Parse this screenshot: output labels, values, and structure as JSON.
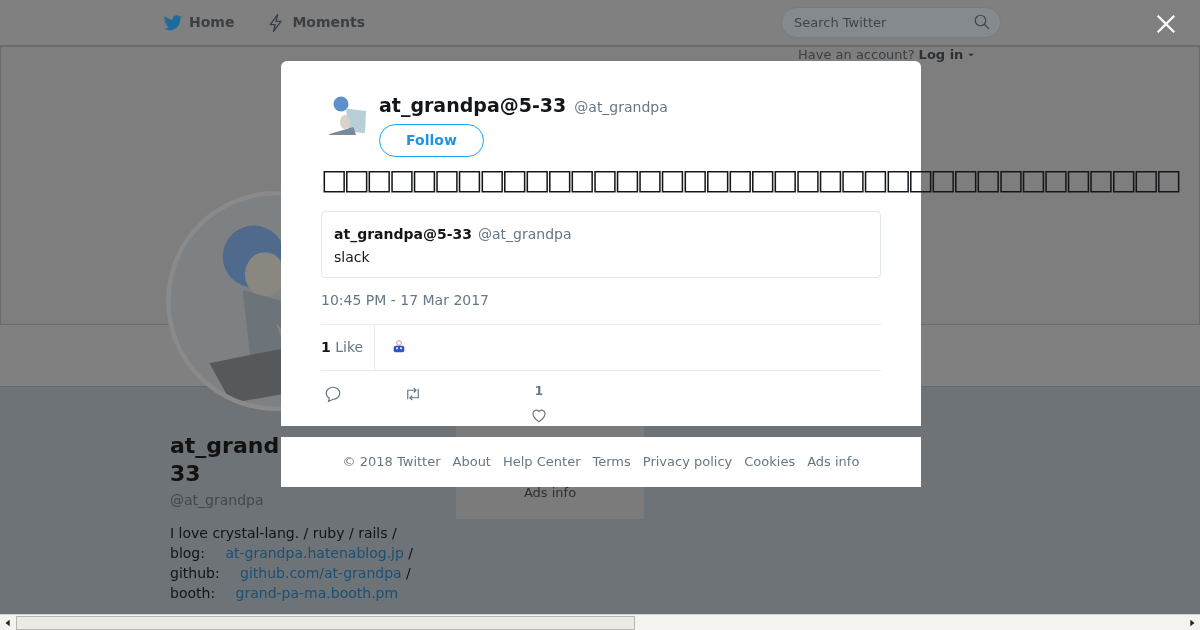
{
  "nav": {
    "items": [
      {
        "label": "Home",
        "kind": "bird",
        "selected": false
      },
      {
        "label": "Moments",
        "kind": "bolt",
        "selected": false
      }
    ],
    "search": {
      "placeholder": "Search Twitter"
    },
    "account_prompt": "Have an account?",
    "login": "Log in"
  },
  "profile": {
    "name_lines": [
      "at_grand",
      "33"
    ],
    "handle": "@at_grandpa",
    "bio": [
      {
        "kind": "text",
        "text": "I love crystal-lang. / ruby / rails / blog:"
      },
      {
        "kind": "link",
        "text": "at-grandpa.hatenablog.jp"
      },
      {
        "kind": "text",
        "text": "/ github:"
      },
      {
        "kind": "link",
        "text": "github.com/at-grandpa"
      },
      {
        "kind": "text",
        "text": "/ booth:"
      },
      {
        "kind": "link",
        "text": "grand-pa-ma.booth.pm"
      }
    ]
  },
  "side_card": {
    "link": "Ads info"
  },
  "tweet": {
    "name": "at_grandpa@5-33",
    "handle": "@at_grandpa",
    "follow": "Follow",
    "text": "□□□□□□□□□□□□□□□□□□□□□□□□□□□□□□□□□□□□□□",
    "quote": {
      "name": "at_grandpa@5-33",
      "handle": "@at_grandpa",
      "text": "slack"
    },
    "time": "10:45 PM - 17 Mar 2017",
    "likes_count": "1",
    "likes_label": "Like",
    "actions": [
      {
        "kind": "reply"
      },
      {
        "kind": "retweet"
      },
      {
        "kind": "like",
        "count": "1"
      }
    ]
  },
  "footer": [
    "© 2018 Twitter",
    "About",
    "Help Center",
    "Terms",
    "Privacy policy",
    "Cookies",
    "Ads info"
  ]
}
